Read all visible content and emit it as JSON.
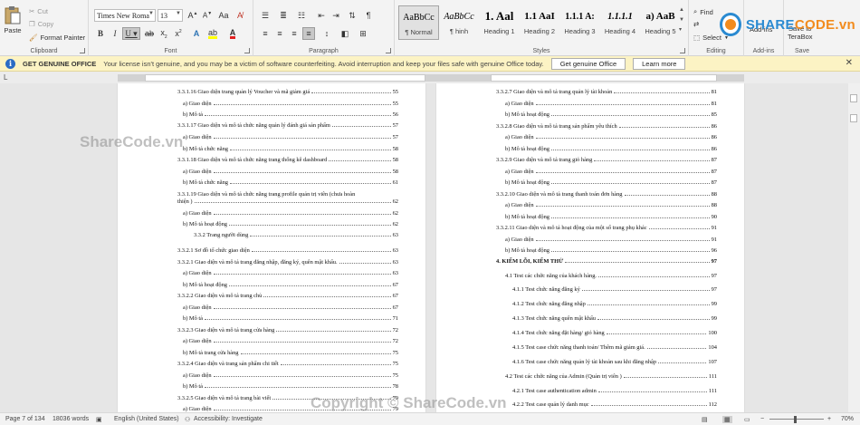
{
  "ribbon": {
    "clipboard": {
      "paste": "Paste",
      "cut": "Cut",
      "copy": "Copy",
      "format_painter": "Format Painter",
      "label": "Clipboard"
    },
    "font": {
      "family": "Times New Roman",
      "size": "13",
      "label": "Font"
    },
    "paragraph": {
      "label": "Paragraph"
    },
    "styles": {
      "label": "Styles",
      "items": [
        {
          "preview": "AaBbCc",
          "name": "¶ Normal"
        },
        {
          "preview": "AaBbCc",
          "name": "¶ hinh"
        },
        {
          "preview": "1. Aal",
          "name": "Heading 1"
        },
        {
          "preview": "1.1 AaI",
          "name": "Heading 2"
        },
        {
          "preview": "1.1.1 A:",
          "name": "Heading 3"
        },
        {
          "preview": "1.1.1.1",
          "name": "Heading 4"
        },
        {
          "preview": "a) AaB",
          "name": "Heading 5"
        }
      ]
    },
    "editing": {
      "find": "Find",
      "select": "Select",
      "label": "Editing"
    },
    "addins": {
      "label": "Add-ins",
      "item": "Add-ins"
    },
    "save": {
      "line1": "Save to",
      "line2": "TeraBox",
      "label": "Save"
    }
  },
  "message_bar": {
    "title": "GET GENUINE OFFICE",
    "text": "Your license isn't genuine, and you may be a victim of software counterfeiting. Avoid interruption and keep your files safe with genuine Office today.",
    "button_primary": "Get genuine Office",
    "button_secondary": "Learn more"
  },
  "left_page": [
    {
      "t": "3.3.1.16 Giao diện trang quản lý Voucher và mã giảm giá",
      "p": "55",
      "indent": 1
    },
    {
      "t": "a) Giao diện",
      "p": "55",
      "indent": 2
    },
    {
      "t": "b) Mô tả",
      "p": "56",
      "indent": 2
    },
    {
      "t": "3.3.1.17 Giao diện và mô tả chức năng quản lý đánh giá sản phẩm",
      "p": "57",
      "indent": 1
    },
    {
      "t": "a) Giao diện",
      "p": "57",
      "indent": 2
    },
    {
      "t": "b) Mô tả chức năng",
      "p": "58",
      "indent": 2
    },
    {
      "t": "3.3.1.18 Giao diện và mô tả chức năng trang thống kê dashboard",
      "p": "58",
      "indent": 1
    },
    {
      "t": "a) Giao diện",
      "p": "58",
      "indent": 2
    },
    {
      "t": "b) Mô tả chức năng",
      "p": "61",
      "indent": 2
    },
    {
      "t": "3.3.1.19 Giao diện và mô tả chức năng trang profile quản trị viên (chưa hoàn",
      "p": "",
      "indent": 1
    },
    {
      "t": "thiện )",
      "p": "62",
      "indent": 1
    },
    {
      "t": "a) Giao diện",
      "p": "62",
      "indent": 2
    },
    {
      "t": "b) Mô tả hoạt động",
      "p": "62",
      "indent": 2
    },
    {
      "t": "3.3.2 Trang người dùng",
      "p": "63",
      "indent": 3
    },
    {
      "t": "3.3.2.1 Sơ đồ tổ chức giao diện",
      "p": "63",
      "indent": 1
    },
    {
      "t": "3.3.2.1 Giao diện và mô tả trang đăng nhập, đăng ký, quên mật khẩu.",
      "p": "63",
      "indent": 1
    },
    {
      "t": "a) Giao diện",
      "p": "63",
      "indent": 2
    },
    {
      "t": "b) Mô tả hoạt động",
      "p": "67",
      "indent": 2
    },
    {
      "t": "3.3.2.2 Giao diện và mô tả trang chủ",
      "p": "67",
      "indent": 1
    },
    {
      "t": "a) Giao diện",
      "p": "67",
      "indent": 2
    },
    {
      "t": "b) Mô tả",
      "p": "71",
      "indent": 2
    },
    {
      "t": "3.3.2.3 Giao diện và mô tả trang cửa hàng",
      "p": "72",
      "indent": 1
    },
    {
      "t": "a) Giao diện",
      "p": "72",
      "indent": 2
    },
    {
      "t": "b) Mô tả trang cửa hàng",
      "p": "75",
      "indent": 2
    },
    {
      "t": "3.3.2.4 Giao diện và trang sản phẩm chi tiết",
      "p": "75",
      "indent": 1
    },
    {
      "t": "a) Giao diện",
      "p": "75",
      "indent": 2
    },
    {
      "t": "b) Mô tả",
      "p": "78",
      "indent": 2
    },
    {
      "t": "3.3.2.5 Giao diện và mô tả trang bài viết",
      "p": "79",
      "indent": 1
    },
    {
      "t": "a) Giao diện",
      "p": "79",
      "indent": 2
    }
  ],
  "right_page": [
    {
      "t": "3.3.2.7 Giao diện và mô tả trang quản lý tài khoản",
      "p": "81",
      "indent": 1
    },
    {
      "t": "a) Giao diện",
      "p": "81",
      "indent": 2
    },
    {
      "t": "b) Mô tả hoạt động",
      "p": "85",
      "indent": 2
    },
    {
      "t": "3.3.2.8 Giao diện và mô tả trang sản phẩm yêu thích",
      "p": "86",
      "indent": 1
    },
    {
      "t": "a) Giao diện",
      "p": "86",
      "indent": 2
    },
    {
      "t": "b) Mô tả hoạt động",
      "p": "86",
      "indent": 2
    },
    {
      "t": "3.3.2.9 Giao diện và mô tả trang giỏ hàng",
      "p": "87",
      "indent": 1
    },
    {
      "t": "a) Giao diện",
      "p": "87",
      "indent": 2
    },
    {
      "t": "b) Mô tả hoạt động",
      "p": "87",
      "indent": 2
    },
    {
      "t": "3.3.2.10 Giao diện và mô tả trang thanh toán đơn hàng",
      "p": "88",
      "indent": 1
    },
    {
      "t": "a) Giao diện",
      "p": "88",
      "indent": 2
    },
    {
      "t": "b) Mô tả hoạt động",
      "p": "90",
      "indent": 2
    },
    {
      "t": "3.3.2.11 Giao diện và mô tả hoạt động của một số trang phụ khác",
      "p": "91",
      "indent": 1
    },
    {
      "t": "a) Giao diện",
      "p": "91",
      "indent": 2
    },
    {
      "t": "b) Mô tả hoạt động",
      "p": "96",
      "indent": 2
    },
    {
      "t": "4. KIỂM LỖI, KIỂM THỬ",
      "p": "97",
      "indent": 1,
      "bold": true
    },
    {
      "t": "4.1 Test các chức năng của khách hàng.",
      "p": "97",
      "indent": 2
    },
    {
      "t": "4.1.1 Test chức năng đăng ký",
      "p": "97",
      "indent": 3
    },
    {
      "t": "4.1.2 Test chức năng đăng nhập",
      "p": "99",
      "indent": 3
    },
    {
      "t": "4.1.3 Test chức năng quên mật khẩu",
      "p": "99",
      "indent": 3
    },
    {
      "t": "4.1.4 Test chức năng đặt hàng/ giỏ hàng",
      "p": "100",
      "indent": 3
    },
    {
      "t": "4.1.5 Test case chức năng thanh toán/ Thêm mã giảm giá.",
      "p": "104",
      "indent": 3
    },
    {
      "t": "4.1.6 Test case chức năng quản lý tài khoản sau khi đăng nhập",
      "p": "107",
      "indent": 3
    },
    {
      "t": "4.2 Test các chức năng của Admin (Quản trị viên )",
      "p": "111",
      "indent": 2
    },
    {
      "t": "4.2.1 Test case authentication admin",
      "p": "111",
      "indent": 3
    },
    {
      "t": "4.2.2 Test case quản lý danh mục",
      "p": "112",
      "indent": 3
    }
  ],
  "status": {
    "page": "Page 7 of 134",
    "words": "18036 words",
    "language": "English (United States)",
    "accessibility": "Accessibility: Investigate",
    "zoom": "70%"
  },
  "watermarks": {
    "top": "ShareCode.vn",
    "bottom": "Copyright © ShareCode.vn",
    "logo_a": "SHARE",
    "logo_b": "CODE.vn"
  }
}
